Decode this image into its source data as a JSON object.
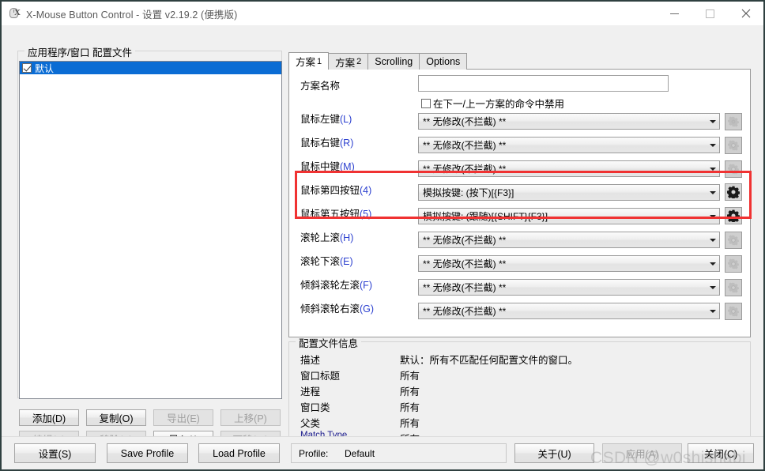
{
  "window": {
    "title": "X-Mouse Button Control - 设置 v2.19.2 (便携版)",
    "icon": "xmouse-app-icon",
    "controls": {
      "minimize": "minimize-icon",
      "maximize": "maximize-icon",
      "close": "close-icon"
    },
    "border_color": "#2f4040"
  },
  "profiles_panel": {
    "group_label": "应用程序/窗口 配置文件",
    "items": [
      {
        "label": "默认",
        "checked": true,
        "selected": true
      }
    ],
    "buttons": [
      {
        "label": "添加(D)",
        "name": "add-button",
        "enabled": true
      },
      {
        "label": "复制(O)",
        "name": "copy-button",
        "enabled": true
      },
      {
        "label": "导出(E)",
        "name": "export-button",
        "enabled": false
      },
      {
        "label": "上移(P)",
        "name": "move-up-button",
        "enabled": false
      },
      {
        "label": "编辑(T)",
        "name": "edit-button",
        "enabled": false
      },
      {
        "label": "移除(V)",
        "name": "remove-button",
        "enabled": false
      },
      {
        "label": "导入(I)",
        "name": "import-button",
        "enabled": true
      },
      {
        "label": "下移(W)",
        "name": "move-down-button",
        "enabled": false
      }
    ]
  },
  "tabs": [
    {
      "label": "方案",
      "num": "1",
      "active": true
    },
    {
      "label": "方案",
      "num": "2",
      "active": false
    },
    {
      "label": "Scrolling",
      "num": "",
      "active": false
    },
    {
      "label": "Options",
      "num": "",
      "active": false
    }
  ],
  "scheme": {
    "name_label": "方案名称",
    "name_value": "",
    "name_placeholder": "",
    "disable_checkbox_label": "在下一/上一方案的命令中禁用",
    "disable_checkbox_checked": false,
    "toolbar_icons": [
      {
        "name": "duplicate-scheme-icon",
        "color": "#2b3fcf"
      },
      {
        "name": "swap-arrows-icon",
        "color": "#2b3fcf"
      },
      {
        "name": "delete-scheme-icon",
        "color": "#e02b2b"
      }
    ]
  },
  "bindings": [
    {
      "label": "鼠标左键",
      "accel": "(L)",
      "value": "** 无修改(不拦截) **",
      "gear_enabled": false,
      "highlighted": false
    },
    {
      "label": "鼠标右键",
      "accel": "(R)",
      "value": "** 无修改(不拦截) **",
      "gear_enabled": false,
      "highlighted": false
    },
    {
      "label": "鼠标中键",
      "accel": "(M)",
      "value": "** 无修改(不拦截) **",
      "gear_enabled": false,
      "highlighted": false
    },
    {
      "label": "鼠标第四按钮",
      "accel": "(4)",
      "value": "模拟按键: (按下)[{F3}]",
      "gear_enabled": true,
      "highlighted": true
    },
    {
      "label": "鼠标第五按钮",
      "accel": "(5)",
      "value": "模拟按键: (跟随)[{SHIFT}{F3}]",
      "gear_enabled": true,
      "highlighted": true
    },
    {
      "label": "滚轮上滚",
      "accel": "(H)",
      "value": "** 无修改(不拦截) **",
      "gear_enabled": false,
      "highlighted": false
    },
    {
      "label": "滚轮下滚",
      "accel": "(E)",
      "value": "** 无修改(不拦截) **",
      "gear_enabled": false,
      "highlighted": false
    },
    {
      "label": "倾斜滚轮左滚",
      "accel": "(F)",
      "value": "** 无修改(不拦截) **",
      "gear_enabled": false,
      "highlighted": false
    },
    {
      "label": "倾斜滚轮右滚",
      "accel": "(G)",
      "value": "** 无修改(不拦截) **",
      "gear_enabled": false,
      "highlighted": false
    }
  ],
  "profile_info": {
    "group_label": "配置文件信息",
    "rows": [
      {
        "label": "描述",
        "value": "默认：所有不匹配任何配置文件的窗口。",
        "english": false
      },
      {
        "label": "窗口标题",
        "value": "所有",
        "english": false
      },
      {
        "label": "进程",
        "value": "所有",
        "english": false
      },
      {
        "label": "窗口类",
        "value": "所有",
        "english": false
      },
      {
        "label": "父类",
        "value": "所有",
        "english": false
      },
      {
        "label": "Match Type",
        "value": "所有",
        "english": true
      }
    ]
  },
  "bottom_bar": {
    "settings_button": "设置(S)",
    "save_profile_button": "Save Profile",
    "load_profile_button": "Load Profile",
    "profile_label": "Profile:",
    "profile_value": "Default",
    "about_button": "关于(U)",
    "apply_button": "应用(A)",
    "apply_enabled": false,
    "close_button": "关闭(C)"
  },
  "watermark": "CSDN @w0shishabi",
  "colors": {
    "selection_blue": "#0a6cd4",
    "highlight_red": "#f03232",
    "accent_blue": "#2b3fcf",
    "window_bg": "#f0f0f0"
  }
}
